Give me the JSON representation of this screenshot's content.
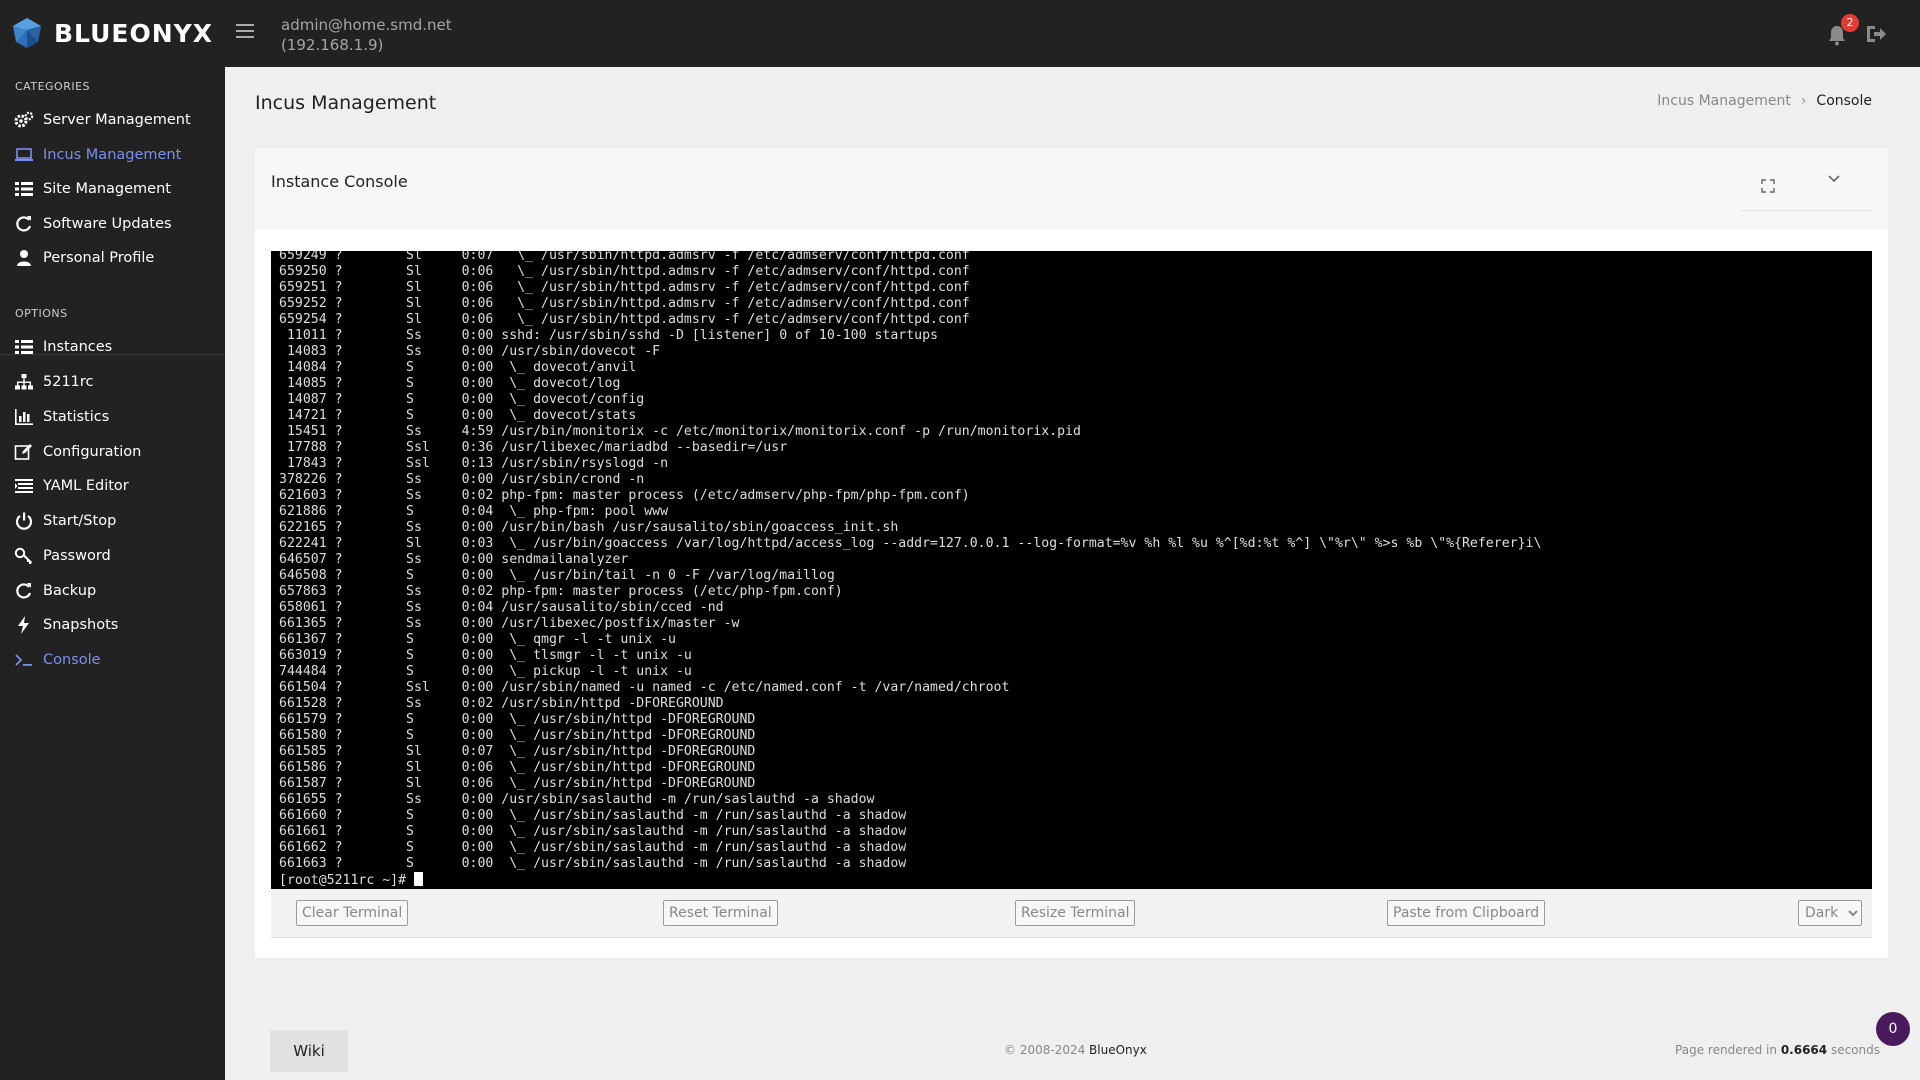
{
  "app": {
    "brand": "BLUEONYX"
  },
  "header": {
    "user": "admin@home.smd.net",
    "ip": "(192.168.1.9)",
    "notifications": "2"
  },
  "sidebar": {
    "categories_title": "CATEGORIES",
    "categories": [
      {
        "label": "Server Management",
        "icon": "gears-icon"
      },
      {
        "label": "Incus Management",
        "icon": "laptop-icon",
        "active": true
      },
      {
        "label": "Site Management",
        "icon": "list-icon"
      },
      {
        "label": "Software Updates",
        "icon": "refresh-icon"
      },
      {
        "label": "Personal Profile",
        "icon": "user-icon"
      }
    ],
    "options_title": "OPTIONS",
    "options": [
      {
        "label": "Instances",
        "icon": "list-icon"
      },
      {
        "label": "5211rc",
        "icon": "sitemap-icon"
      },
      {
        "label": "Statistics",
        "icon": "bar-chart-icon"
      },
      {
        "label": "Configuration",
        "icon": "edit-icon"
      },
      {
        "label": "YAML Editor",
        "icon": "yaml-icon"
      },
      {
        "label": "Start/Stop",
        "icon": "power-icon"
      },
      {
        "label": "Password",
        "icon": "key-icon"
      },
      {
        "label": "Backup",
        "icon": "refresh-icon"
      },
      {
        "label": "Snapshots",
        "icon": "bolt-icon"
      },
      {
        "label": "Console",
        "icon": "terminal-icon",
        "active": true
      }
    ]
  },
  "page": {
    "title": "Incus Management",
    "breadcrumb": [
      "Incus Management",
      "Console"
    ]
  },
  "card": {
    "title": "Instance Console"
  },
  "terminal": {
    "lines": [
      "659249 ?        Sl     0:07   \\_ /usr/sbin/httpd.admsrv -f /etc/admserv/conf/httpd.conf",
      "659250 ?        Sl     0:06   \\_ /usr/sbin/httpd.admsrv -f /etc/admserv/conf/httpd.conf",
      "659251 ?        Sl     0:06   \\_ /usr/sbin/httpd.admsrv -f /etc/admserv/conf/httpd.conf",
      "659252 ?        Sl     0:06   \\_ /usr/sbin/httpd.admsrv -f /etc/admserv/conf/httpd.conf",
      "659254 ?        Sl     0:06   \\_ /usr/sbin/httpd.admsrv -f /etc/admserv/conf/httpd.conf",
      " 11011 ?        Ss     0:00 sshd: /usr/sbin/sshd -D [listener] 0 of 10-100 startups",
      " 14083 ?        Ss     0:00 /usr/sbin/dovecot -F",
      " 14084 ?        S      0:00  \\_ dovecot/anvil",
      " 14085 ?        S      0:00  \\_ dovecot/log",
      " 14087 ?        S      0:00  \\_ dovecot/config",
      " 14721 ?        S      0:00  \\_ dovecot/stats",
      " 15451 ?        Ss     4:59 /usr/bin/monitorix -c /etc/monitorix/monitorix.conf -p /run/monitorix.pid",
      " 17788 ?        Ssl    0:36 /usr/libexec/mariadbd --basedir=/usr",
      " 17843 ?        Ssl    0:13 /usr/sbin/rsyslogd -n",
      "378226 ?        Ss     0:00 /usr/sbin/crond -n",
      "621603 ?        Ss     0:02 php-fpm: master process (/etc/admserv/php-fpm/php-fpm.conf)",
      "621886 ?        S      0:04  \\_ php-fpm: pool www",
      "622165 ?        Ss     0:00 /usr/bin/bash /usr/sausalito/sbin/goaccess_init.sh",
      "622241 ?        Sl     0:03  \\_ /usr/bin/goaccess /var/log/httpd/access_log --addr=127.0.0.1 --log-format=%v %h %l %u %^[%d:%t %^] \\\"%r\\\" %>s %b \\\"%{Referer}i\\",
      "646507 ?        Ss     0:00 sendmailanalyzer",
      "646508 ?        S      0:00  \\_ /usr/bin/tail -n 0 -F /var/log/maillog",
      "657863 ?        Ss     0:02 php-fpm: master process (/etc/php-fpm.conf)",
      "658061 ?        Ss     0:04 /usr/sausalito/sbin/cced -nd",
      "661365 ?        Ss     0:00 /usr/libexec/postfix/master -w",
      "661367 ?        S      0:00  \\_ qmgr -l -t unix -u",
      "663019 ?        S      0:00  \\_ tlsmgr -l -t unix -u",
      "744484 ?        S      0:00  \\_ pickup -l -t unix -u",
      "661504 ?        Ssl    0:00 /usr/sbin/named -u named -c /etc/named.conf -t /var/named/chroot",
      "661528 ?        Ss     0:02 /usr/sbin/httpd -DFOREGROUND",
      "661579 ?        S      0:00  \\_ /usr/sbin/httpd -DFOREGROUND",
      "661580 ?        S      0:00  \\_ /usr/sbin/httpd -DFOREGROUND",
      "661585 ?        Sl     0:07  \\_ /usr/sbin/httpd -DFOREGROUND",
      "661586 ?        Sl     0:06  \\_ /usr/sbin/httpd -DFOREGROUND",
      "661587 ?        Sl     0:06  \\_ /usr/sbin/httpd -DFOREGROUND",
      "661655 ?        Ss     0:00 /usr/sbin/saslauthd -m /run/saslauthd -a shadow",
      "661660 ?        S      0:00  \\_ /usr/sbin/saslauthd -m /run/saslauthd -a shadow",
      "661661 ?        S      0:00  \\_ /usr/sbin/saslauthd -m /run/saslauthd -a shadow",
      "661662 ?        S      0:00  \\_ /usr/sbin/saslauthd -m /run/saslauthd -a shadow",
      "661663 ?        S      0:00  \\_ /usr/sbin/saslauthd -m /run/saslauthd -a shadow"
    ],
    "prompt": "[root@5211rc ~]# "
  },
  "terminal_bar": {
    "clear": "Clear Terminal",
    "reset": "Reset Terminal",
    "resize": "Resize Terminal",
    "paste": "Paste from Clipboard",
    "theme_options": [
      "Dark"
    ]
  },
  "footer": {
    "wiki": "Wiki",
    "copyright_prefix": "© 2008-2024 ",
    "copyright_brand": "BlueOnyx",
    "rendered_prefix": "Page rendered in ",
    "rendered_time": "0.6664",
    "rendered_suffix": " seconds",
    "counter": "0"
  }
}
